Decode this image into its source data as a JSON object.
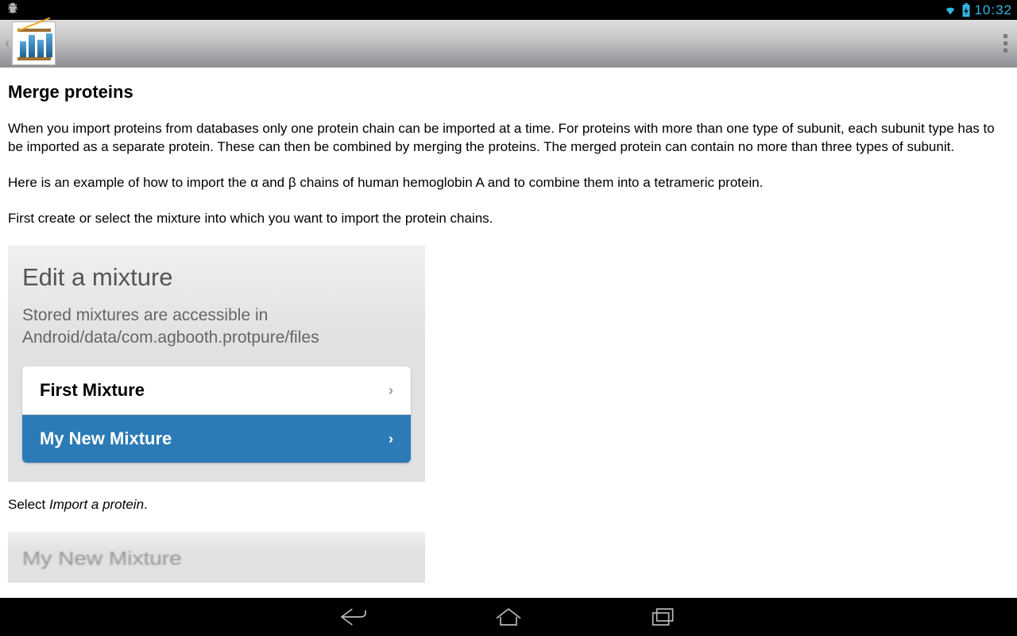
{
  "statusbar": {
    "time": "10:32"
  },
  "page": {
    "title": "Merge proteins",
    "para1": "When you import proteins from databases only one protein chain can be imported at a time. For proteins with more than one type of subunit, each subunit type has to be imported as a separate protein. These can then be combined by merging the proteins. The merged protein can contain no more than three types of subunit.",
    "para2": "Here is an example of how to import the α and β chains of human hemoglobin A and to combine them into a tetrameric protein.",
    "para3": "First create or select the mixture into which you want to import the protein chains.",
    "card1": {
      "title": "Edit a mixture",
      "sub": "Stored mixtures are accessible in Android/data/com.agbooth.protpure/files",
      "items": [
        {
          "label": "First Mixture",
          "selected": false
        },
        {
          "label": "My New Mixture",
          "selected": true
        }
      ]
    },
    "para4_prefix": "Select ",
    "para4_em": "Import a protein",
    "para4_suffix": ".",
    "card2": {
      "title_preview": "My New Mixture"
    }
  }
}
